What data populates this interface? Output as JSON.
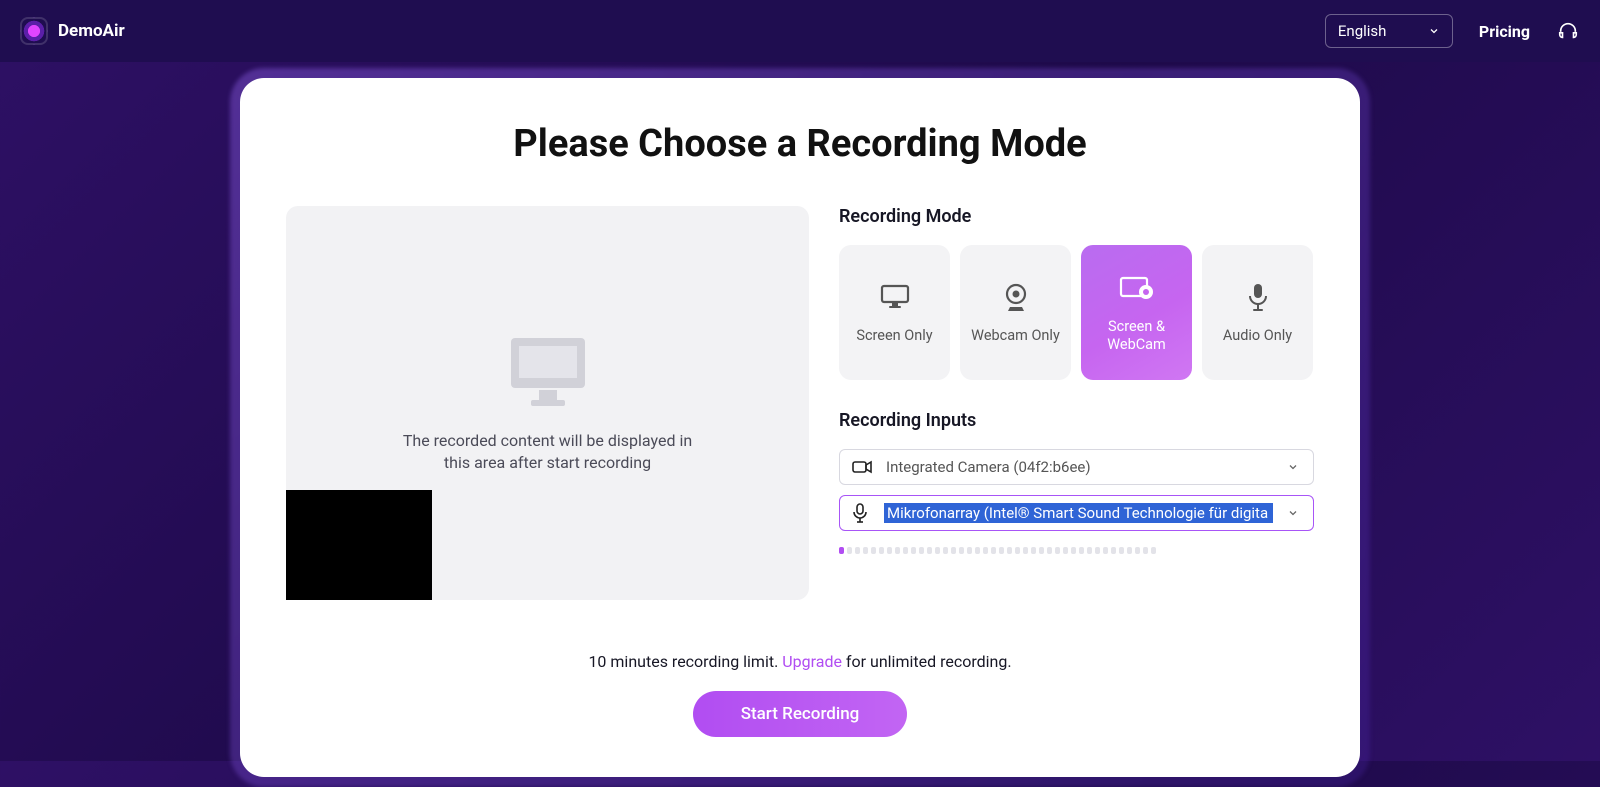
{
  "nav": {
    "brand": "DemoAir",
    "language": "English",
    "pricing": "Pricing"
  },
  "title": "Please Choose a Recording Mode",
  "preview_text_line1": "The recorded content will be displayed in",
  "preview_text_line2": "this area after start recording",
  "sections": {
    "mode": "Recording Mode",
    "inputs": "Recording Inputs"
  },
  "modes": [
    {
      "label": "Screen Only"
    },
    {
      "label": "Webcam Only"
    },
    {
      "label": "Screen & WebCam"
    },
    {
      "label": "Audio Only"
    }
  ],
  "inputs": {
    "camera": "Integrated Camera (04f2:b6ee)",
    "mic": "Mikrofonarray (Intel® Smart Sound Technologie für digita"
  },
  "bottom": {
    "limit_pre": "10 minutes recording limit. ",
    "upgrade": "Upgrade",
    "limit_post": "  for unlimited recording.",
    "start": "Start Recording"
  }
}
